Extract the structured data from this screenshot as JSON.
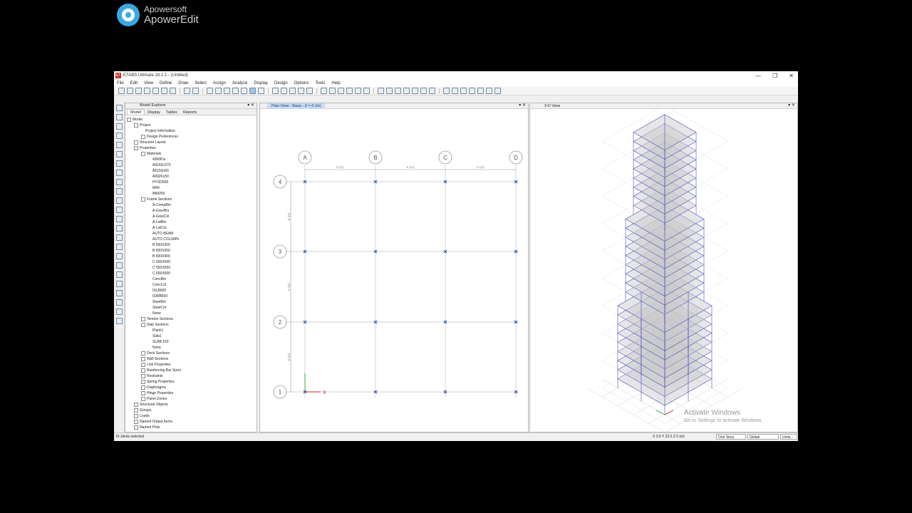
{
  "watermark": {
    "line1": "Apowersoft",
    "line2": "ApowerEdit"
  },
  "window": {
    "title": "ETABS Ultimate 18.1.1 - (Untitled)",
    "app_icon": "ET",
    "minimize": "—",
    "restore": "❐",
    "close": "✕"
  },
  "menu": [
    "File",
    "Edit",
    "View",
    "Define",
    "Draw",
    "Select",
    "Assign",
    "Analyze",
    "Display",
    "Design",
    "Options",
    "Tools",
    "Help"
  ],
  "explorer": {
    "title": "Model Explorer",
    "tabs": [
      "Model",
      "Display",
      "Tables",
      "Reports"
    ],
    "tree": [
      {
        "label": "Model",
        "level": 0,
        "exp": true
      },
      {
        "label": "Project",
        "level": 1,
        "exp": true
      },
      {
        "label": "Project Information",
        "level": 2
      },
      {
        "label": "Design Preferences",
        "level": 2,
        "exp": true
      },
      {
        "label": "Structure Layout",
        "level": 1,
        "exp": true
      },
      {
        "label": "Properties",
        "level": 1,
        "exp": true
      },
      {
        "label": "Materials",
        "level": 2,
        "exp": true
      },
      {
        "label": "4000Psi",
        "level": 3
      },
      {
        "label": "A416Gr270",
        "level": 3
      },
      {
        "label": "A615Gr60",
        "level": 3
      },
      {
        "label": "A992Fy50",
        "level": 3
      },
      {
        "label": "HYSD500",
        "level": 3
      },
      {
        "label": "M40",
        "level": 3
      },
      {
        "label": "Mild250",
        "level": 3
      },
      {
        "label": "Frame Sections",
        "level": 2,
        "exp": true
      },
      {
        "label": "A-CompBm",
        "level": 3
      },
      {
        "label": "A-GravBm",
        "level": 3
      },
      {
        "label": "A-GravCol",
        "level": 3
      },
      {
        "label": "A-LatBm",
        "level": 3
      },
      {
        "label": "A-LatCol",
        "level": 3
      },
      {
        "label": "AUTO BEAM",
        "level": 3
      },
      {
        "label": "AUTO COLUMN",
        "level": 3
      },
      {
        "label": "B 500X300",
        "level": 3
      },
      {
        "label": "B 550X350",
        "level": 3
      },
      {
        "label": "B 600X400",
        "level": 3
      },
      {
        "label": "C 500X500",
        "level": 3
      },
      {
        "label": "C 550X550",
        "level": 3
      },
      {
        "label": "C 600X600",
        "level": 3
      },
      {
        "label": "ConcBm",
        "level": 3
      },
      {
        "label": "ConcCol",
        "level": 3
      },
      {
        "label": "ISLB600",
        "level": 3
      },
      {
        "label": "ISWB550",
        "level": 3
      },
      {
        "label": "SteelBm",
        "level": 3
      },
      {
        "label": "SteelCol",
        "level": 3
      },
      {
        "label": "None",
        "level": 3
      },
      {
        "label": "Tendon Sections",
        "level": 2,
        "exp": true
      },
      {
        "label": "Slab Sections",
        "level": 2,
        "exp": true
      },
      {
        "label": "Plank1",
        "level": 3
      },
      {
        "label": "Slab1",
        "level": 3
      },
      {
        "label": "SLAB 150",
        "level": 3
      },
      {
        "label": "None",
        "level": 3
      },
      {
        "label": "Deck Sections",
        "level": 2,
        "exp": true
      },
      {
        "label": "Wall Sections",
        "level": 2,
        "exp": true
      },
      {
        "label": "Link Properties",
        "level": 2,
        "exp": true
      },
      {
        "label": "Reinforcing Bar Sizes",
        "level": 2,
        "exp": true
      },
      {
        "label": "Restraints",
        "level": 2,
        "exp": true
      },
      {
        "label": "Spring Properties",
        "level": 2,
        "exp": true
      },
      {
        "label": "Diaphragms",
        "level": 2,
        "exp": true
      },
      {
        "label": "Hinge Properties",
        "level": 2,
        "exp": true
      },
      {
        "label": "Panel Zones",
        "level": 2,
        "exp": true
      },
      {
        "label": "Structural Objects",
        "level": 1,
        "exp": true
      },
      {
        "label": "Groups",
        "level": 1,
        "exp": true
      },
      {
        "label": "Loads",
        "level": 1,
        "exp": true
      },
      {
        "label": "Named Output Items",
        "level": 1,
        "exp": true
      },
      {
        "label": "Named Plots",
        "level": 1,
        "exp": true
      }
    ]
  },
  "plan_view": {
    "tab": "Plan View - Base - Z = 0 (m)",
    "grid_x": [
      "A",
      "B",
      "C",
      "D"
    ],
    "grid_y": [
      "4",
      "3",
      "2",
      "1"
    ],
    "dims_x": [
      "6 (m)",
      "6 (m)",
      "6 (m)"
    ],
    "dims_y": [
      "6 (m)",
      "6 (m)",
      "6 (m)"
    ],
    "axis_x": "X",
    "axis_y": "Y"
  },
  "view3d": {
    "tab": "3-D View"
  },
  "panel_ctl": "▾ ✕",
  "status": {
    "left": "16 Joints selected",
    "coord": "X 3.9  Y 23.2  Z 0 (m)",
    "story": "One Story",
    "coord_sys": "Global",
    "units": "Units..."
  },
  "activate": {
    "line1": "Activate Windows",
    "line2": "Go to Settings to activate Windows."
  },
  "colors": {
    "grid": "#c0c0c0",
    "selection": "#1f3fcc",
    "wire": "#4646c8",
    "slab": "#bdbdbd"
  }
}
